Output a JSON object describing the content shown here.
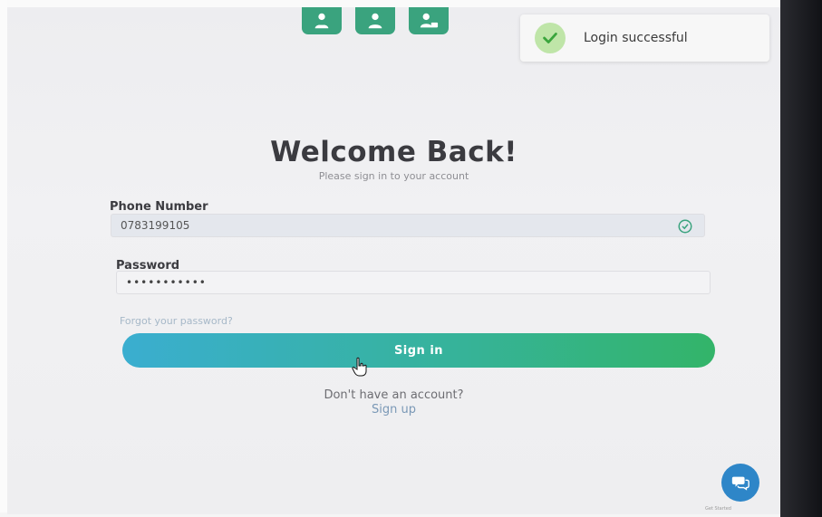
{
  "roles": [
    "user-icon",
    "user-icon",
    "user-card-icon"
  ],
  "toast": {
    "message": "Login successful",
    "icon": "check-circle-icon"
  },
  "heading": {
    "title": "Welcome Back!",
    "subtitle": "Please sign in to your account"
  },
  "form": {
    "phone_label": "Phone Number",
    "phone_value": "0783199105",
    "password_label": "Password",
    "password_value": "•••••••••••",
    "forgot_link": "Forgot your password?",
    "signin_button": "Sign in"
  },
  "footer": {
    "no_account_text": "Don't have an account?",
    "signup_link": "Sign up"
  },
  "chat": {
    "caption": "Get Started"
  },
  "colors": {
    "primary_green": "#3aa37e",
    "button_gradient_start": "#3aaed0",
    "button_gradient_end": "#33b469",
    "chat_blue": "#2e86c8"
  }
}
